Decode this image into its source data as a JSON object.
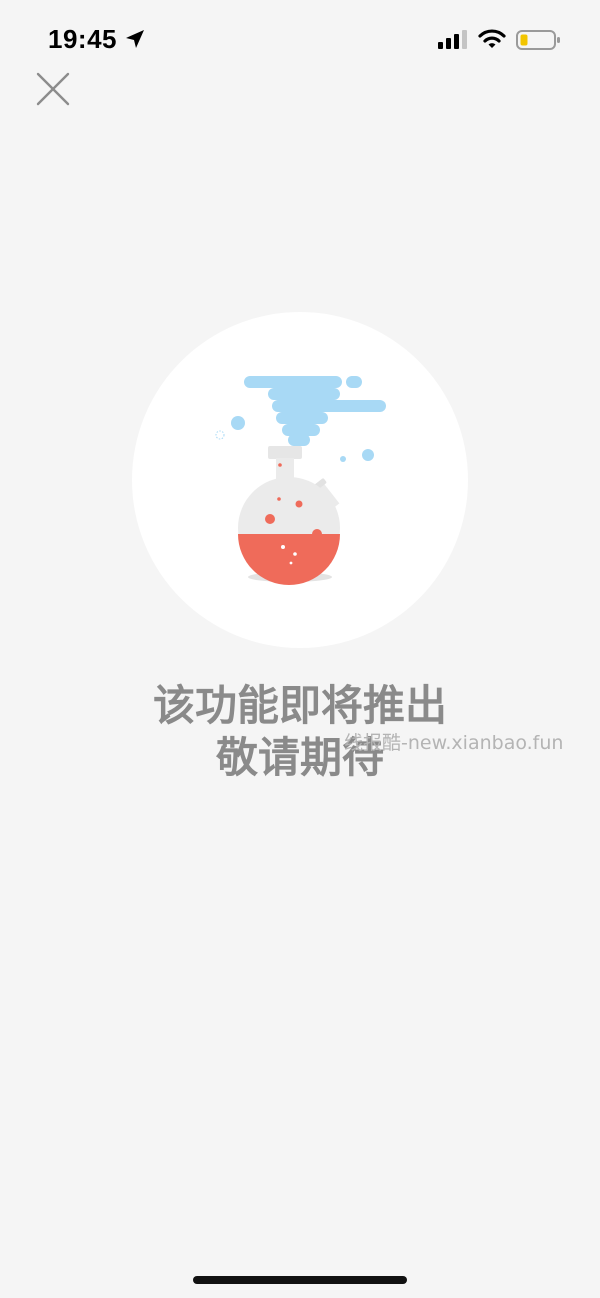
{
  "status_bar": {
    "time": "19:45",
    "icons": [
      "location-arrow-icon",
      "cellular-signal-icon",
      "wifi-icon",
      "battery-low-icon"
    ],
    "battery_color": "#f2c500"
  },
  "close_button": {
    "icon": "close-icon"
  },
  "illustration": {
    "subject": "flask-icon",
    "colors": {
      "circle": "#ffffff",
      "cloud": "#a8d9f5",
      "flask": "#ebebeb",
      "liquid": "#ef6b5a"
    }
  },
  "message": {
    "line1": "该功能即将推出",
    "line2": "敬请期待",
    "color": "#8a8a8a"
  },
  "watermark": {
    "text": "线报酷-new.xianbao.fun"
  }
}
